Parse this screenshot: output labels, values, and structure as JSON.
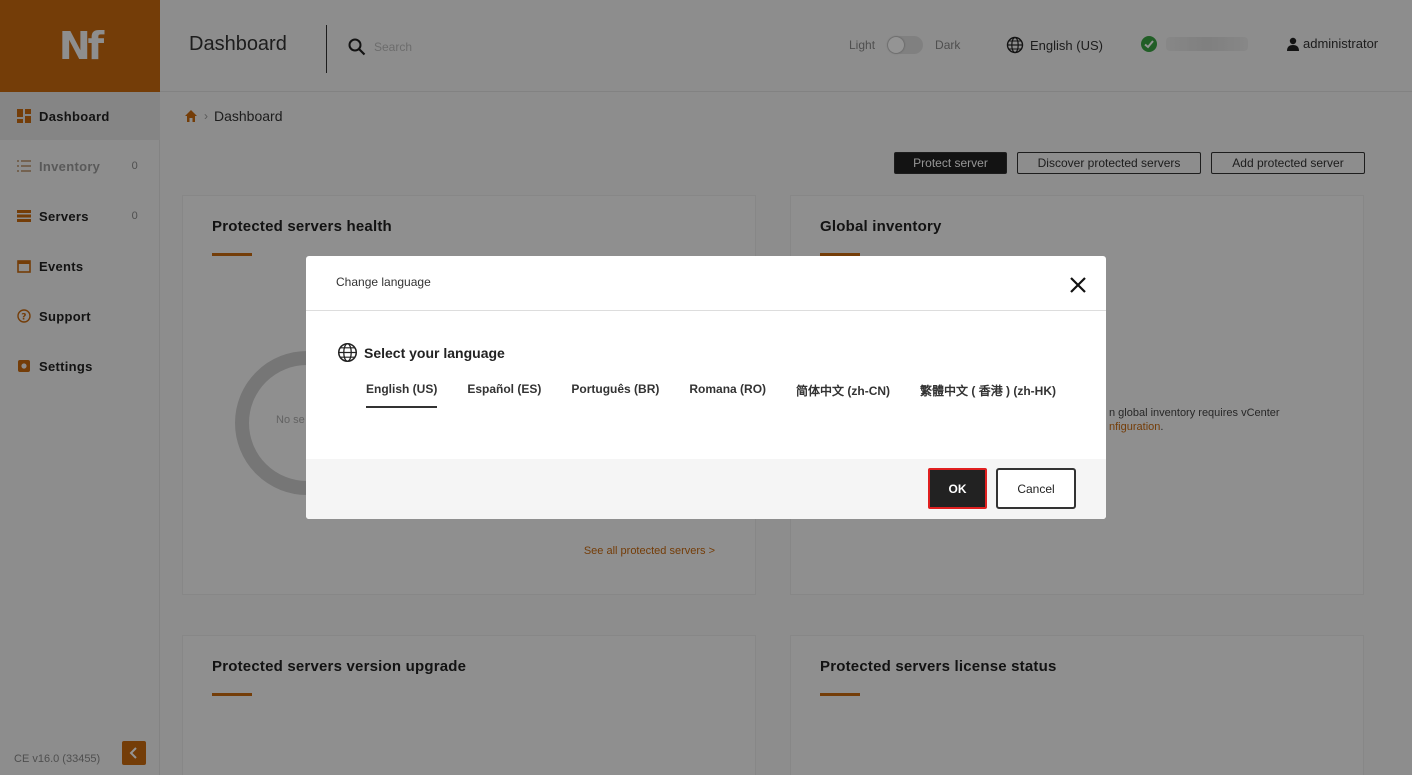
{
  "app": {
    "logo_text": "Nf",
    "version": "CE v16.0 (33455)",
    "accent": "#c8690f"
  },
  "sidebar": {
    "items": [
      {
        "label": "Dashboard",
        "icon": "dashboard-grid-icon"
      },
      {
        "label": "Inventory",
        "icon": "list-icon",
        "count": "0"
      },
      {
        "label": "Servers",
        "icon": "servers-icon",
        "count": "0"
      },
      {
        "label": "Events",
        "icon": "calendar-icon"
      },
      {
        "label": "Support",
        "icon": "help-circle-icon"
      },
      {
        "label": "Settings",
        "icon": "gear-icon"
      }
    ]
  },
  "header": {
    "title": "Dashboard",
    "search_placeholder": "Search",
    "theme_light": "Light",
    "theme_dark": "Dark",
    "language": "English (US)",
    "user": "administrator"
  },
  "breadcrumb": {
    "current": "Dashboard"
  },
  "actions": {
    "protect": "Protect server",
    "discover": "Discover protected servers",
    "add": "Add protected server"
  },
  "cards": {
    "health": {
      "title": "Protected servers health",
      "donut_text": "No se",
      "see_all": "See all protected servers >"
    },
    "inventory": {
      "title": "Global inventory",
      "text_line1": "n global inventory requires vCenter",
      "text_link": "nfiguration",
      "text_end": "."
    },
    "upgrade": {
      "title": "Protected servers version upgrade"
    },
    "license": {
      "title": "Protected servers license status"
    }
  },
  "modal": {
    "title": "Change language",
    "select_label": "Select your language",
    "languages": [
      "English (US)",
      "Español (ES)",
      "Português (BR)",
      "Romana (RO)",
      "简体中文 (zh-CN)",
      "繁體中文 ( 香港 ) (zh-HK)"
    ],
    "selected": "English (US)",
    "ok": "OK",
    "cancel": "Cancel"
  }
}
